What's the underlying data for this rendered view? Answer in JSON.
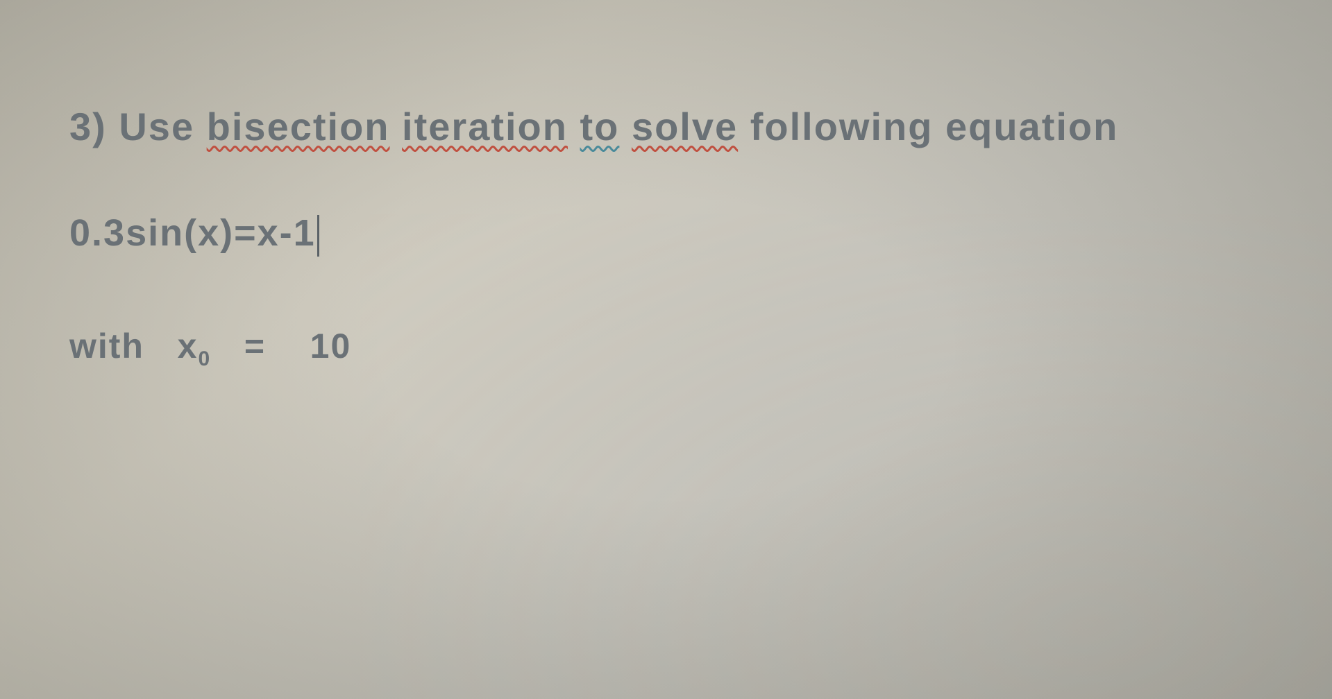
{
  "problem": {
    "number": "3)",
    "instruction_part1": "Use",
    "instruction_part2": "bisection",
    "instruction_part3": "iteration",
    "instruction_part4": "to",
    "instruction_part5": "solve",
    "instruction_part6": "following equation",
    "equation": "0.3sin(x)=x-1",
    "condition_prefix": "with",
    "condition_var": "x",
    "condition_sub": "0",
    "condition_eq": "=",
    "condition_val": "10"
  }
}
